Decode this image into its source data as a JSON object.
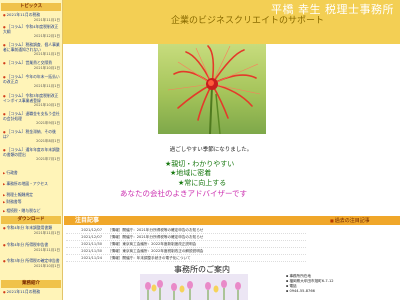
{
  "header": {
    "brand": "平橋 幸生 税理士事務所",
    "subtitle": "企業のビジネスクリエイトのサポート"
  },
  "sidebar": {
    "topics_heading": "トピックス",
    "topics": [
      {
        "text": "2021年11月の税務",
        "date": "2021年11月1日"
      },
      {
        "text": "［コラム］令和4年度税制改正大綱",
        "date": "2021年12月1日"
      },
      {
        "text": "［コラム］税務調査、個人事業者に事前通知されない",
        "date": "2021年11月1日"
      },
      {
        "text": "［コラム］営業費と交際費",
        "date": "2021年10月1日"
      },
      {
        "text": "［コラム］今年の年末一括払いの改正点",
        "date": "2021年11月1日"
      },
      {
        "text": "［コラム］令和3年度税制改正 インボイス事業者登録",
        "date": "2021年10月1日"
      },
      {
        "text": "［コラム］退職金を支払う会社の会計処理",
        "date": "2021年9月1日"
      },
      {
        "text": "［コラム］税金滞納、その後は？",
        "date": "2021年8月1日"
      },
      {
        "text": "［コラム］通年年度の年末調整の書類の提出",
        "date": "2021年7月1日"
      }
    ],
    "rows": [
      "行政書",
      "事務所の地図・アクセス",
      "税理士報酬規定",
      "財務書等",
      "相続税・贈与税など"
    ],
    "download_heading": "ダウンロード",
    "downloads": [
      {
        "text": "令和4年分 年末調整用書類",
        "date": "2021年11月1日"
      },
      {
        "text": "令和4年分 所得税申告書",
        "date": "2021年11月1日"
      },
      {
        "text": "令和3年分 所得税の確定申告書",
        "date": "2021年10月1日"
      }
    ],
    "footer_heading": "業務紹介",
    "footer_item": {
      "text": "2021年11月の税務",
      "date": "2021年11月1日"
    }
  },
  "main": {
    "hero_alt": "彼岸花",
    "message": "過ごしやすい季節になりました。",
    "slogans": [
      "★親切・わかりやすい",
      "★地域に密着",
      "★常に向上する"
    ],
    "slogan_b": "あなたの会社のよきアドバイザーです"
  },
  "news": {
    "title": "注目記事",
    "archive": "過去の注目記事",
    "items": [
      {
        "date": "2021/12/07",
        "text": "［情報］開催庁：2021年分所得税等の確定申告のお知らせ"
      },
      {
        "date": "2021/12/07",
        "text": "［情報］開催庁：2021年分所得税等の確定申告のお知らせ"
      },
      {
        "date": "2021/11/30",
        "text": "［情報］東京商工会議所：2022年度新制度改正説明会"
      },
      {
        "date": "2021/11/30",
        "text": "［情報］東京商工会議所：2022年度税制改正の解説説明会"
      },
      {
        "date": "2021/11/24",
        "text": "［情報］開催庁：年末調整手続きの電子化について"
      }
    ]
  },
  "office": {
    "title": "事務所のご案内",
    "info": [
      "事務所所在地",
      "福岡県大牟田市旭町6-7-12",
      "電話",
      "0944-55-8766"
    ]
  },
  "colors": {
    "header": "#f3cf54",
    "sidebar": "#fff4b8",
    "news_bar": "#f0a72a",
    "slogan_green": "#1a7a12",
    "slogan_pink": "#cc2fb0",
    "hero_flower": "#e43a2a"
  }
}
